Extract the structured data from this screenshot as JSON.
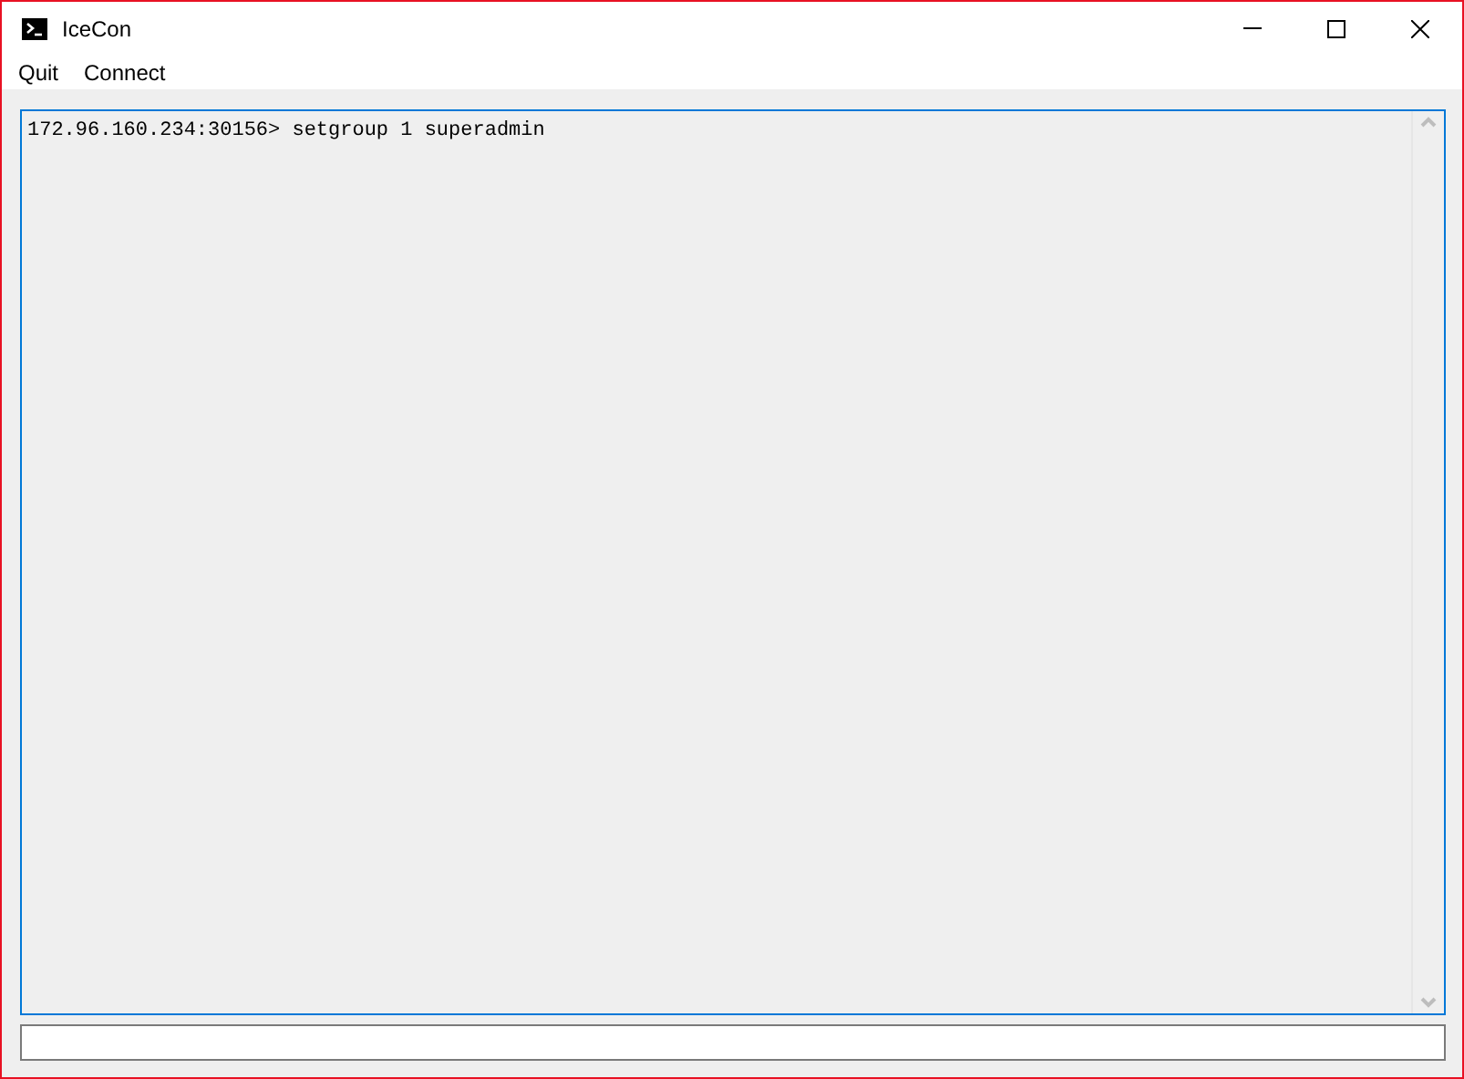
{
  "window": {
    "title": "IceCon"
  },
  "menu": [
    "Quit",
    "Connect"
  ],
  "console": {
    "lines": [
      "172.96.160.234:30156> setgroup 1 superadmin"
    ]
  }
}
